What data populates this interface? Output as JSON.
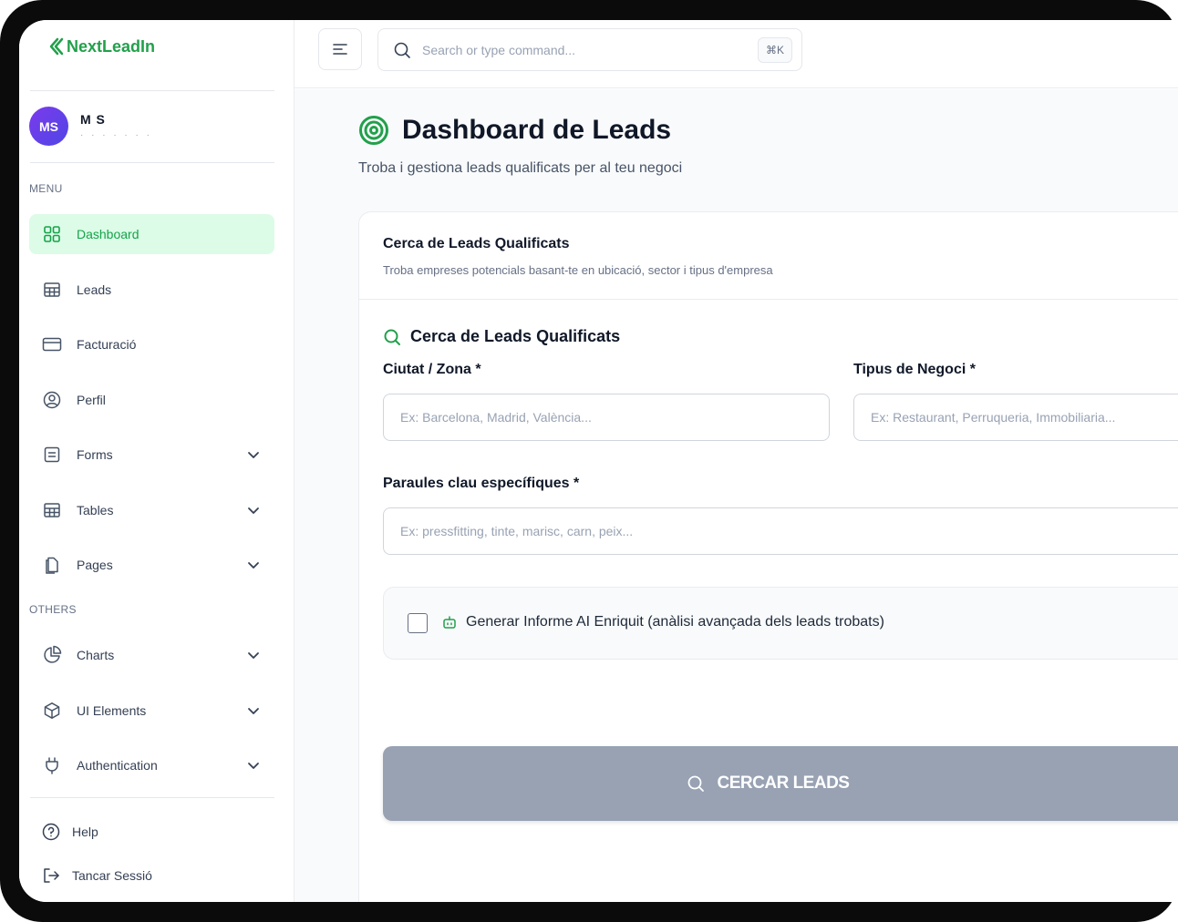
{
  "brand": {
    "name": "NextLeadIn",
    "color": "#22a04b"
  },
  "user": {
    "initials": "MS",
    "name": "M S",
    "subtitle": "· · · · · · ·"
  },
  "sidebar": {
    "menu_label": "MENU",
    "others_label": "OTHERS",
    "items": [
      {
        "label": "Dashboard",
        "icon": "grid-icon",
        "active": true
      },
      {
        "label": "Leads",
        "icon": "table-icon"
      },
      {
        "label": "Facturació",
        "icon": "credit-card-icon"
      },
      {
        "label": "Perfil",
        "icon": "user-circle-icon"
      },
      {
        "label": "Forms",
        "icon": "form-icon",
        "expandable": true
      },
      {
        "label": "Tables",
        "icon": "table-icon",
        "expandable": true
      },
      {
        "label": "Pages",
        "icon": "pages-icon",
        "expandable": true
      }
    ],
    "others": [
      {
        "label": "Charts",
        "icon": "pie-chart-icon",
        "expandable": true
      },
      {
        "label": "UI Elements",
        "icon": "box-icon",
        "expandable": true
      },
      {
        "label": "Authentication",
        "icon": "plug-icon",
        "expandable": true
      }
    ],
    "footer": [
      {
        "label": "Help",
        "icon": "help-icon"
      },
      {
        "label": "Tancar Sessió",
        "icon": "logout-icon"
      }
    ]
  },
  "topbar": {
    "search_placeholder": "Search or type command...",
    "shortcut": "⌘K"
  },
  "page": {
    "title": "Dashboard de Leads",
    "subtitle": "Troba i gestiona leads qualificats per al teu negoci"
  },
  "card": {
    "title": "Cerca de Leads Qualificats",
    "description": "Troba empreses potencials basant-te en ubicació, sector i tipus d'empresa",
    "form_title": "Cerca de Leads Qualificats",
    "city_label": "Ciutat / Zona *",
    "city_placeholder": "Ex: Barcelona, Madrid, València...",
    "business_label": "Tipus de Negoci *",
    "business_placeholder": "Ex: Restaurant, Perruqueria, Immobiliaria...",
    "keywords_label": "Paraules clau específiques *",
    "keywords_placeholder": "Ex: pressfitting, tinte, marisc, carn, peix...",
    "ai_report_label": "Generar Informe AI Enriquit (anàlisi avançada dels leads trobats)",
    "ai_report_checked": false,
    "search_button": "CERCAR LEADS"
  },
  "colors": {
    "accent": "#22a04b",
    "active_bg": "#dcfce7",
    "button_disabled": "#98a2b3"
  }
}
